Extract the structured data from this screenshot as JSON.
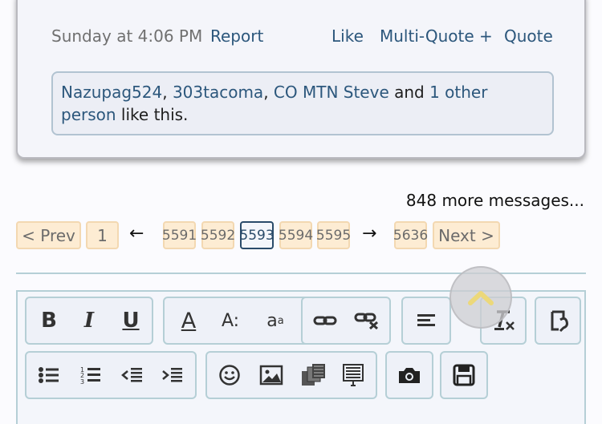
{
  "post": {
    "date": "Sunday at 4:06 PM",
    "report": "Report",
    "like": "Like",
    "multiquote": "Multi-Quote +",
    "quote": "Quote",
    "likes": {
      "users": [
        "Nazupag524",
        "303tacoma",
        "CO MTN Steve"
      ],
      "sep1": ", ",
      "sep2": ", ",
      "and": " and ",
      "others": "1 other person",
      "suffix": " like this."
    }
  },
  "more_messages": "848 more messages...",
  "pagination": {
    "prev": "< Prev",
    "first": "1",
    "back_arrow": "←",
    "pages": [
      "5591",
      "5592",
      "5593",
      "5594",
      "5595"
    ],
    "current": "5593",
    "fwd_arrow": "→",
    "last": "5636",
    "next": "Next >"
  },
  "toolbar": {
    "bold": "B",
    "italic": "I",
    "underline": "U",
    "text_color": "A",
    "font_size": "A:",
    "font_family": "a",
    "icons": [
      "bold-icon",
      "italic-icon",
      "underline-icon",
      "text-color-icon",
      "font-size-icon",
      "font-family-icon",
      "link-icon",
      "unlink-icon",
      "align-icon",
      "remove-format-icon",
      "paste-icon",
      "bullet-list-icon",
      "numbered-list-icon",
      "outdent-icon",
      "indent-icon",
      "smiley-icon",
      "image-icon",
      "media-icon",
      "quote-icon",
      "camera-icon",
      "save-draft-icon"
    ]
  },
  "colors": {
    "link": "#2c577c",
    "page_bg": "#fdecd3",
    "page_border": "#f3d8b1",
    "current_border": "#2a4b6a"
  }
}
